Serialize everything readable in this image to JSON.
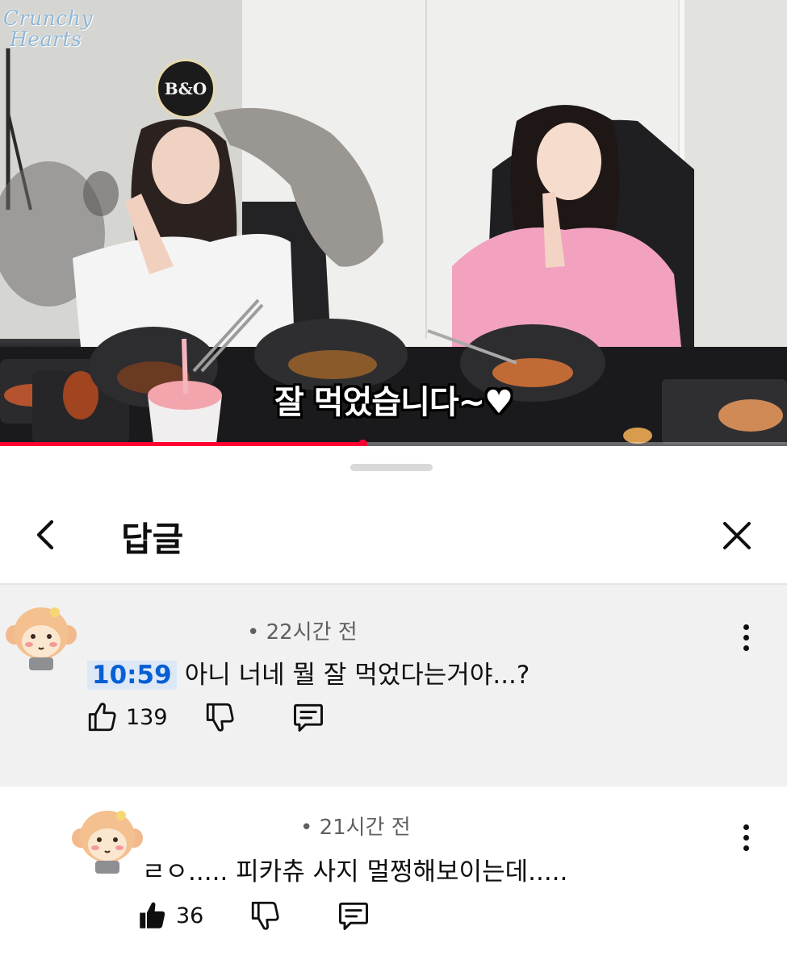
{
  "video": {
    "watermark_line1": "Crunchy",
    "watermark_line2": "Hearts",
    "logo_text": "B&O",
    "caption": "잘 먹었습니다~♥",
    "progress": 0.46,
    "accent_color": "#ff0033"
  },
  "sheet": {
    "title": "답글",
    "back_icon": "chevron-left-icon",
    "close_icon": "close-icon"
  },
  "comments": [
    {
      "time_ago": "• 22시간 전",
      "timestamp": "10:59",
      "text": "아니 너네 뭘 잘 먹었다는거야...?",
      "likes": "139",
      "liked": false
    },
    {
      "time_ago": "• 21시간 전",
      "timestamp": "",
      "text": "ㄹㅇ..... 피카츄 사지 멀쩡해보이는데.....",
      "likes": "36",
      "liked": true
    }
  ]
}
